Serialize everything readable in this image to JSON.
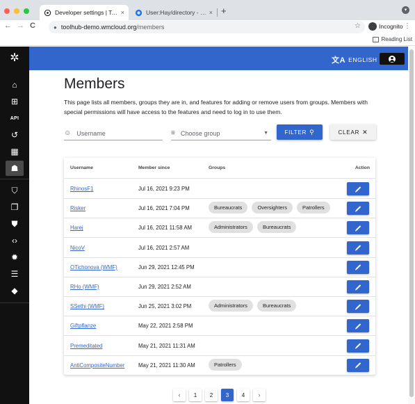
{
  "browser": {
    "tabs": [
      {
        "title": "Developer settings | Toolhub",
        "active": true,
        "close": "×"
      },
      {
        "title": "User:Hay/directory - Wikitech",
        "active": false,
        "close": "×"
      }
    ],
    "new_tab": "+",
    "back": "←",
    "forward": "→",
    "reload": "C",
    "url_host": "toolhub-demo.wmcloud.org",
    "url_path": "/members",
    "bookmark_icon": "☆",
    "profile_label": "Incognito",
    "menu_icon": "⋮",
    "reading_list": "Reading List",
    "window_menu": "▾"
  },
  "app_bar": {
    "language": "ENGLISH",
    "language_icon": "文A"
  },
  "sidebar": {
    "logo": "✲",
    "items": [
      {
        "icon": "home-icon",
        "glyph": "⌂"
      },
      {
        "icon": "add-tool-icon",
        "glyph": "⊞"
      },
      {
        "icon": "api-icon",
        "glyph": "API"
      },
      {
        "icon": "history-icon",
        "glyph": "↺"
      },
      {
        "icon": "qr-code-icon",
        "glyph": "▦"
      },
      {
        "icon": "members-icon",
        "glyph": "☗",
        "active": true
      },
      {
        "icon": "privacy-icon",
        "glyph": "⛉"
      },
      {
        "icon": "feedback-icon",
        "glyph": "❐"
      },
      {
        "icon": "bug-report-icon",
        "glyph": "⛊"
      },
      {
        "icon": "code-icon",
        "glyph": "‹›"
      },
      {
        "icon": "settings-gear-icon",
        "glyph": "✹"
      },
      {
        "icon": "document-icon",
        "glyph": "☰"
      },
      {
        "icon": "directions-icon",
        "glyph": "◆"
      }
    ]
  },
  "page": {
    "title": "Members",
    "description": "This page lists all members, groups they are in, and features for adding or remove users from groups. Members with special permissions will have access to the features and need to log in to use them."
  },
  "filters": {
    "username_placeholder": "Username",
    "group_placeholder": "Choose group",
    "filter_label": "FILTER",
    "clear_label": "CLEAR",
    "filter_icon": "⚲",
    "clear_icon": "✕"
  },
  "table": {
    "headers": {
      "username": "Username",
      "member_since": "Member since",
      "groups": "Groups",
      "action": "Action"
    },
    "rows": [
      {
        "username": "RhinosF1",
        "since": "Jul 16, 2021 9:23 PM",
        "groups": []
      },
      {
        "username": "Risker",
        "since": "Jul 16, 2021 7:04 PM",
        "groups": [
          "Bureaucrats",
          "Oversighters",
          "Patrollers"
        ]
      },
      {
        "username": "Harej",
        "since": "Jul 16, 2021 11:58 AM",
        "groups": [
          "Administrators",
          "Bureaucrats"
        ]
      },
      {
        "username": "NicoV",
        "since": "Jul 16, 2021 2:57 AM",
        "groups": []
      },
      {
        "username": "OTichonova (WMF)",
        "since": "Jun 29, 2021 12:45 PM",
        "groups": []
      },
      {
        "username": "RHo (WMF)",
        "since": "Jun 29, 2021 2:52 AM",
        "groups": []
      },
      {
        "username": "SSethi (WMF)",
        "since": "Jun 25, 2021 3:02 PM",
        "groups": [
          "Administrators",
          "Bureaucrats"
        ]
      },
      {
        "username": "Giftpflanze",
        "since": "May 22, 2021 2:58 PM",
        "groups": []
      },
      {
        "username": "Premeditated",
        "since": "May 21, 2021 11:31 AM",
        "groups": []
      },
      {
        "username": "AntiCompositeNumber",
        "since": "May 21, 2021 11:30 AM",
        "groups": [
          "Patrollers"
        ]
      }
    ]
  },
  "pagination": {
    "prev": "‹",
    "next": "›",
    "pages": [
      "1",
      "2",
      "3",
      "4"
    ],
    "current": "3"
  },
  "colors": {
    "primary": "#3366cc",
    "sidebar": "#111111",
    "chip": "#e0e0e0"
  }
}
